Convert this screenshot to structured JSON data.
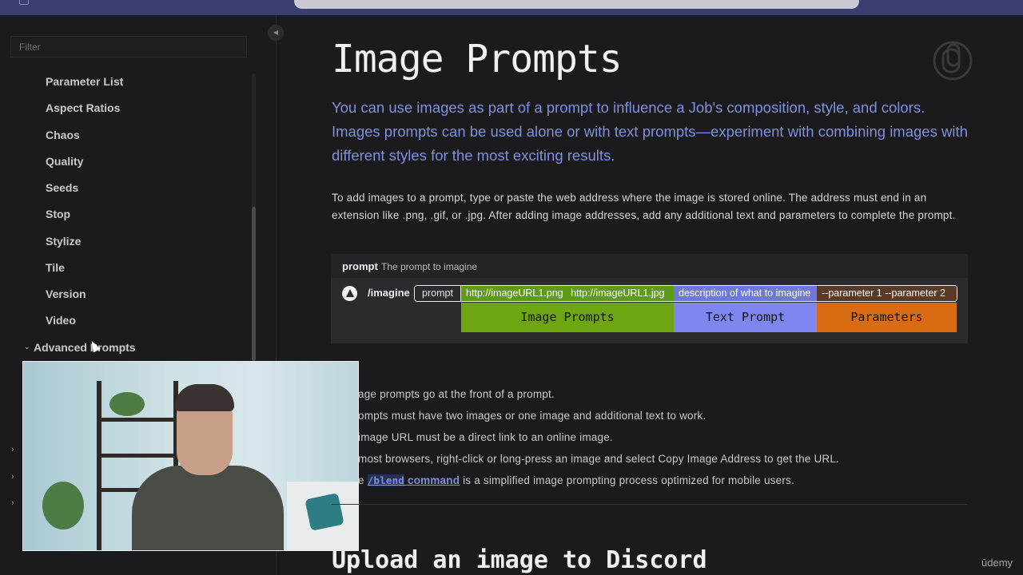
{
  "sidebar": {
    "filter_placeholder": "Filter",
    "collapse_icon": "◀",
    "items": [
      {
        "label": "Parameter List"
      },
      {
        "label": "Aspect Ratios"
      },
      {
        "label": "Chaos"
      },
      {
        "label": "Quality"
      },
      {
        "label": "Seeds"
      },
      {
        "label": "Stop"
      },
      {
        "label": "Stylize"
      },
      {
        "label": "Tile"
      },
      {
        "label": "Version"
      },
      {
        "label": "Video"
      }
    ],
    "section": {
      "label": "Advanced Prompts",
      "chevron": "⌄"
    },
    "side_chevrons": [
      "›",
      "›",
      "›"
    ]
  },
  "page": {
    "title": "Image Prompts",
    "lede": "You can use images as part of a prompt to influence a Job's composition, style, and colors. Images prompts can be used alone or with text prompts—experiment with combining images with different styles for the most exciting results.",
    "paragraph": "To add images to a prompt, type or paste the web address where the image is stored online. The address must end in an extension like .png, .gif, or .jpg. After adding image addresses, add any additional text and parameters to complete the prompt.",
    "figure": {
      "param_name": "prompt",
      "param_desc": "The prompt to imagine",
      "command": "/imagine",
      "seg_prompt": "prompt",
      "seg_images": "http://imageURL1.png http://imageURL1.jpg",
      "seg_text": "description of what to imagine",
      "seg_params": "--parameter 1 --parameter 2",
      "label_images": "Image Prompts",
      "label_text": "Text Prompt",
      "label_params": "Parameters"
    },
    "bullets": [
      {
        "text": "age prompts go at the front of a prompt."
      },
      {
        "text": "ompts must have two images or one image and additional text to work."
      },
      {
        "text": " image URL must be a direct link to an online image."
      },
      {
        "text": "most browsers, right-click or long-press an image and select Copy Image Address to get the URL."
      },
      {
        "pre": "e ",
        "link": "/blend",
        "link2": " command",
        "post": " is a simplified image prompting process optimized for mobile users."
      }
    ],
    "subheading": "Upload an image to Discord"
  },
  "watermark": "ūdemy",
  "colors": {
    "accent": "#7f8fe0",
    "image_prompts": "#6da513",
    "text_prompt": "#7e87f0",
    "parameters": "#d96b12"
  }
}
